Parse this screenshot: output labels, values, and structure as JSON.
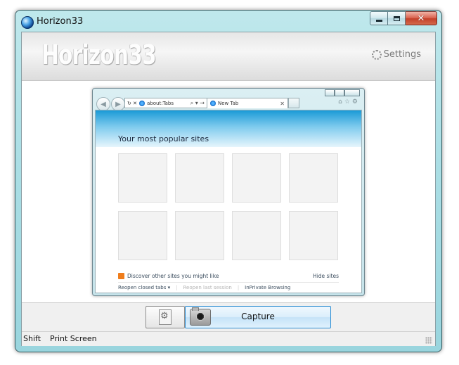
{
  "window": {
    "title": "Horizon33",
    "icon": "app-globe-icon"
  },
  "header": {
    "brand": "Horizon33",
    "settings_label": "Settings"
  },
  "preview": {
    "browser": {
      "address": "about:Tabs",
      "tab_title": "New Tab",
      "heading": "Your most popular sites",
      "tiles_count": 8,
      "discover_text": "Discover other sites you might like",
      "hide_text": "Hide sites",
      "footer_links": [
        "Reopen closed tabs ▾",
        "Reopen last session",
        "InPrivate Browsing"
      ],
      "address_tools": "⌕ ▾ →"
    }
  },
  "toolbar": {
    "capture_label": "Capture"
  },
  "statusbar": {
    "modifier": "Shift",
    "key": "Print Screen"
  },
  "colors": {
    "accent": "#2d8dd2",
    "close_red": "#c3402a"
  }
}
